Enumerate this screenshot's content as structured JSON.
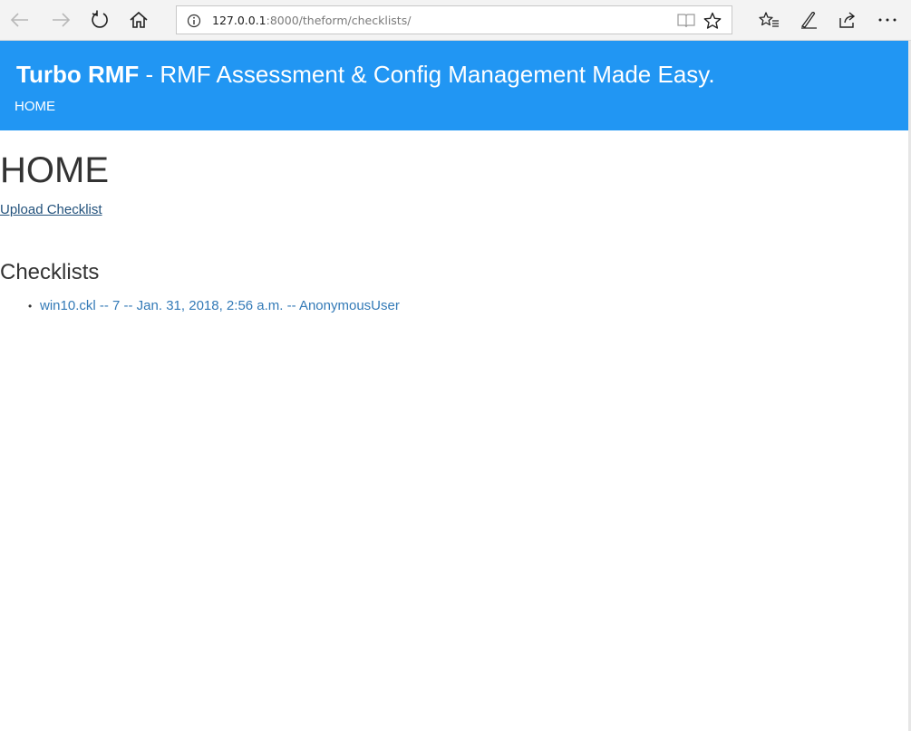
{
  "browser": {
    "url_host": "127.0.0.1",
    "url_rest": ":8000/theform/checklists/"
  },
  "header": {
    "brand": "Turbo RMF",
    "tagline": " - RMF Assessment & Config Management Made Easy.",
    "nav_home": "HOME",
    "color": "#2196f3"
  },
  "main": {
    "title": "HOME",
    "upload_link": "Upload Checklist",
    "section_title": "Checklists",
    "checklists": [
      {
        "label": "win10.ckl -- 7 -- Jan. 31, 2018, 2:56 a.m. -- AnonymousUser"
      }
    ]
  },
  "colors": {
    "link": "#337ab7",
    "link_visited": "#23527c",
    "text": "#333333"
  }
}
